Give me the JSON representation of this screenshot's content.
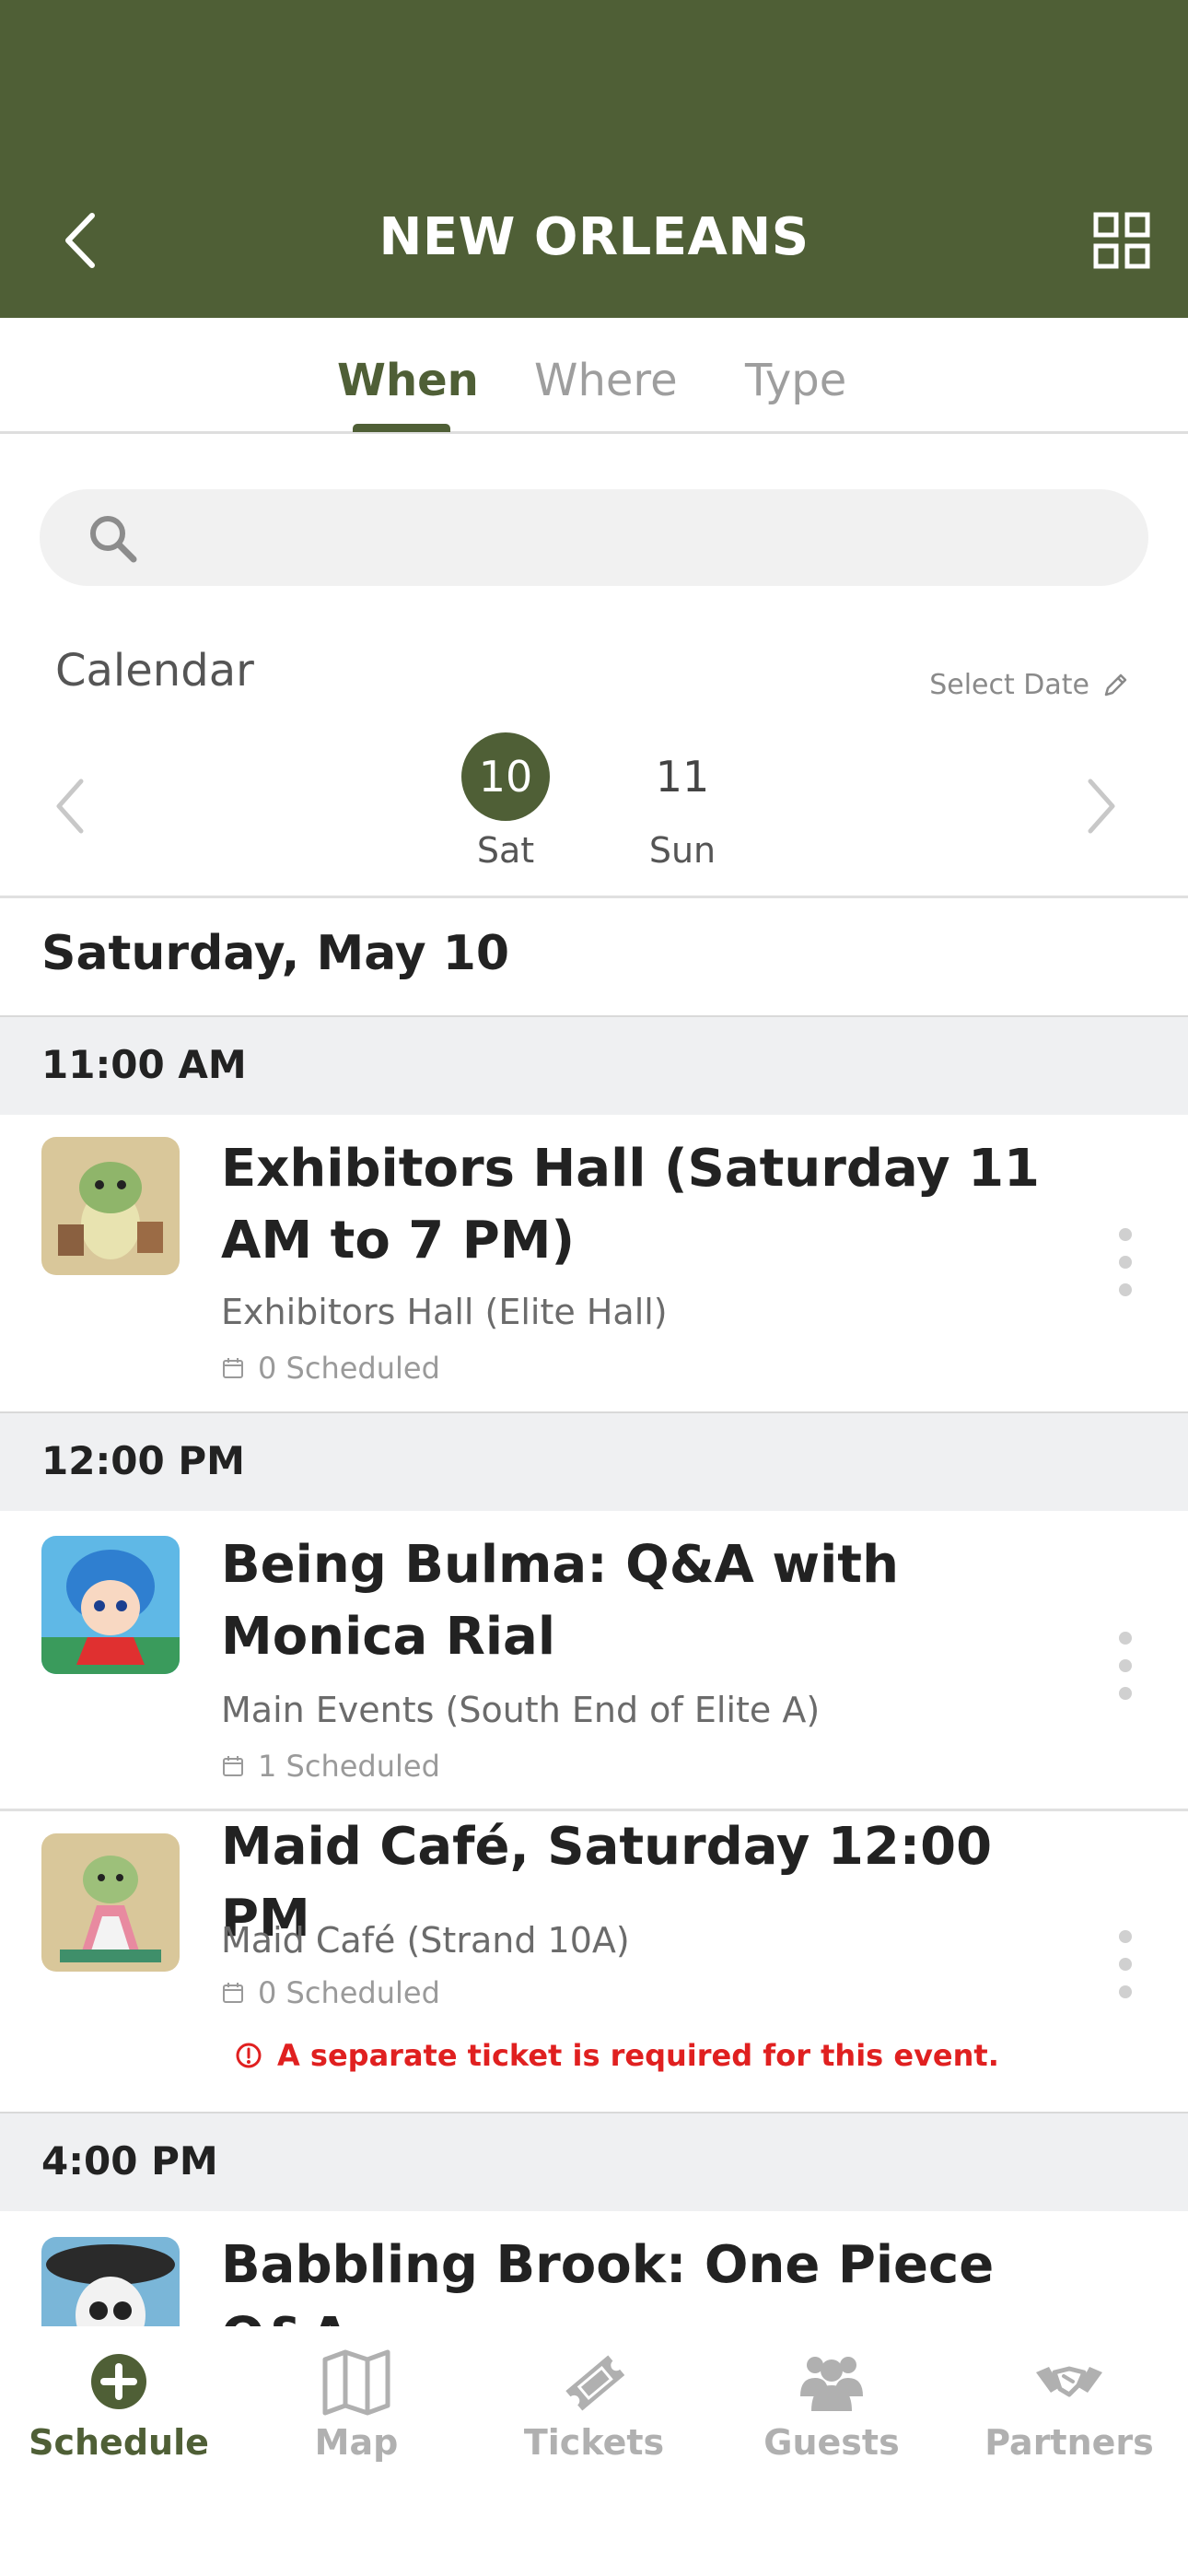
{
  "header": {
    "title": "NEW ORLEANS"
  },
  "tabs": [
    {
      "label": "When",
      "active": true
    },
    {
      "label": "Where",
      "active": false
    },
    {
      "label": "Type",
      "active": false
    }
  ],
  "search": {
    "placeholder": "",
    "value": ""
  },
  "calendar": {
    "label": "Calendar",
    "select_date": "Select Date",
    "days": [
      {
        "num": "10",
        "name": "Sat",
        "selected": true
      },
      {
        "num": "11",
        "name": "Sun",
        "selected": false
      }
    ]
  },
  "date_heading": "Saturday, May 10",
  "time_slots": [
    {
      "time": "11:00 AM"
    },
    {
      "time": "12:00 PM"
    },
    {
      "time": "4:00 PM"
    }
  ],
  "events": [
    {
      "title": "Exhibitors Hall (Saturday 11 AM to 7 PM)",
      "location": "Exhibitors Hall (Elite Hall)",
      "scheduled": "0 Scheduled"
    },
    {
      "title": "Being Bulma: Q&A with Monica Rial",
      "location": "Main Events (South End of Elite A)",
      "scheduled": "1 Scheduled"
    },
    {
      "title": "Maid Café, Saturday 12:00 PM",
      "location": "Maid Café (Strand 10A)",
      "scheduled": "0 Scheduled",
      "warning": "A separate ticket is required for this event."
    },
    {
      "title": "Babbling Brook: One Piece Q&A"
    }
  ],
  "bottom_nav": [
    {
      "label": "Schedule",
      "icon": "plus-circle-icon",
      "active": true
    },
    {
      "label": "Map",
      "icon": "map-icon",
      "active": false
    },
    {
      "label": "Tickets",
      "icon": "ticket-icon",
      "active": false
    },
    {
      "label": "Guests",
      "icon": "guests-icon",
      "active": false
    },
    {
      "label": "Partners",
      "icon": "handshake-icon",
      "active": false
    }
  ],
  "colors": {
    "brand": "#4f5f36",
    "warning": "#e02020",
    "band": "#eff0f2"
  }
}
